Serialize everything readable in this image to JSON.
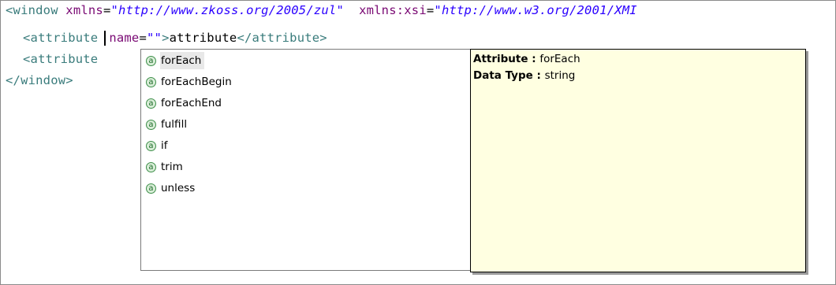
{
  "editor": {
    "line1": {
      "open": "<window",
      "attr1_name": "xmlns",
      "eq1": "=",
      "attr1_value": "\"http://www.zkoss.org/2005/zul\"",
      "attr2_name": "xmlns:xsi",
      "eq2": "=",
      "attr2_value": "\"http://www.w3.org/2001/XMI"
    },
    "line2": {
      "open": "<attribute",
      "attr_name": "name",
      "eq": "=",
      "attr_value": "\"\"",
      "gt": ">",
      "text": "attribute",
      "close": "</attribute>"
    },
    "line3": {
      "open": "<attribute"
    },
    "line4": {
      "close": "</window>"
    }
  },
  "proposals": {
    "icon_glyph": "a",
    "icon_name": "attribute-icon",
    "items": [
      "forEach",
      "forEachBegin",
      "forEachEnd",
      "fulfill",
      "if",
      "trim",
      "unless"
    ],
    "selected_index": 0
  },
  "info": {
    "attribute_label": "Attribute : ",
    "attribute_value": "forEach",
    "datatype_label": "Data Type : ",
    "datatype_value": "string"
  },
  "colors": {
    "tag": "#3a7c7c",
    "attribute_name": "#7a0a74",
    "attribute_value": "#2a00ff",
    "tooltip_bg": "#ffffe1",
    "selection_bg": "#e8e8e8"
  }
}
